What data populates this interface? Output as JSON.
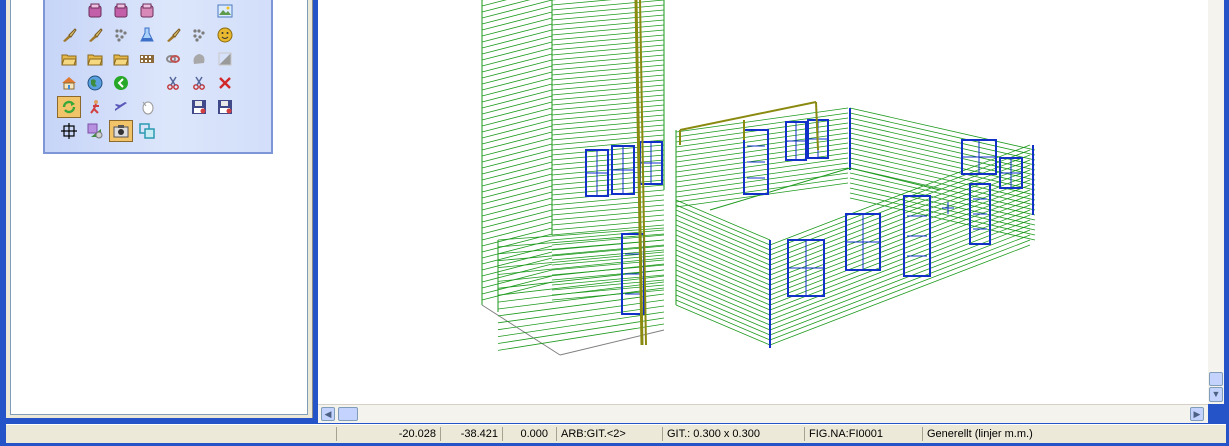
{
  "toolbox": {
    "rows": [
      [
        {
          "icon": "empty-slot-icon",
          "color": "none"
        },
        {
          "icon": "pink-box-icon",
          "color": "#C25FA8"
        },
        {
          "icon": "pink-box-icon",
          "color": "#C25FA8"
        },
        {
          "icon": "pink-box-icon",
          "color": "#D989B8"
        },
        {
          "icon": "empty-slot-icon",
          "color": "none"
        },
        {
          "icon": "empty-slot-icon",
          "color": "none"
        },
        {
          "icon": "picture-icon",
          "color": "#4C7ABF"
        }
      ],
      [
        {
          "icon": "brush-icon",
          "color": "#A0782A"
        },
        {
          "icon": "brush-icon",
          "color": "#A0782A"
        },
        {
          "icon": "grid-dots-icon",
          "color": "#7C7C7C"
        },
        {
          "icon": "flask-icon",
          "color": "#3B6FC8"
        },
        {
          "icon": "brush-icon",
          "color": "#A0782A"
        },
        {
          "icon": "grid-dots-icon",
          "color": "#7C7C7C"
        },
        {
          "icon": "smiley-icon",
          "color": "#E8B82E"
        }
      ],
      [
        {
          "icon": "folder-edit-icon",
          "color": "#E6B84A"
        },
        {
          "icon": "folder-open-icon",
          "color": "#E6B84A"
        },
        {
          "icon": "folder-export-icon",
          "color": "#E6B84A"
        },
        {
          "icon": "film-icon",
          "color": "#8C6A3A"
        },
        {
          "icon": "chain-icon",
          "color": "#8A8A8A"
        },
        {
          "icon": "blob-icon",
          "color": "#A8A8A8"
        },
        {
          "icon": "shape-icon",
          "color": "#9A9A9A"
        }
      ],
      [
        {
          "icon": "home-icon",
          "color": "#E07830"
        },
        {
          "icon": "globe-icon",
          "color": "#3C8C3C"
        },
        {
          "icon": "back-arrow-icon",
          "color": "#28A828"
        },
        {
          "icon": "empty-slot-icon",
          "color": "none"
        },
        {
          "icon": "scissors-icon",
          "color": "#556699"
        },
        {
          "icon": "scissors-icon",
          "color": "#556699"
        },
        {
          "icon": "close-x-icon",
          "color": "#D02828"
        }
      ],
      [
        {
          "icon": "refresh-icon",
          "color": "#38A838",
          "selected": true
        },
        {
          "icon": "person-run-icon",
          "color": "#D04040"
        },
        {
          "icon": "airplane-icon",
          "color": "#5A58B8"
        },
        {
          "icon": "pointer-icon",
          "color": "#9A9A9A"
        },
        {
          "icon": "empty-slot-icon",
          "color": "none"
        },
        {
          "icon": "floppy-icon",
          "color": "#404A8A"
        },
        {
          "icon": "floppy-icon",
          "color": "#404A8A"
        }
      ],
      [
        {
          "icon": "crosshair-icon",
          "color": "#000000"
        },
        {
          "icon": "layers-icon",
          "color": "#7A4FA8"
        },
        {
          "icon": "camera-icon",
          "color": "#555555",
          "selected": true
        },
        {
          "icon": "overlap-icon",
          "color": "#2A9AB0"
        }
      ]
    ]
  },
  "colors": {
    "wall_green": "#1E9A1E",
    "trim_blue": "#1030C8",
    "rod_olive": "#8A8A10",
    "outline_gray": "#808080"
  },
  "statusbar": {
    "x_coord": "-20.028",
    "y_coord": "-38.421",
    "z_coord": "0.000",
    "layer": "ARB:GIT.<2>",
    "grid": "GIT.: 0.300 x 0.300",
    "figure": "FIG.NA:FI0001",
    "mode": "Generellt (linjer m.m.)"
  }
}
